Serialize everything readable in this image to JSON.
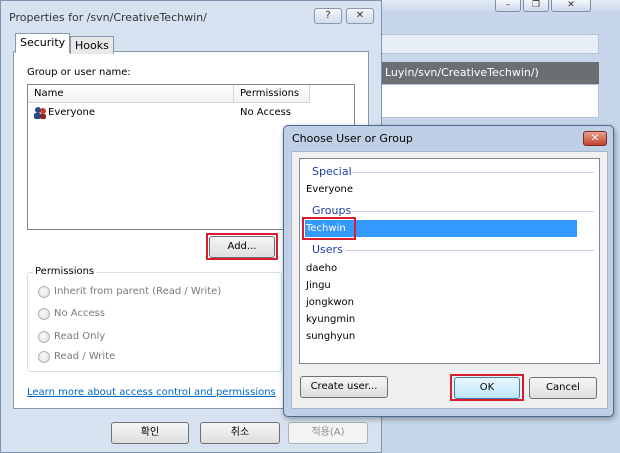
{
  "background_window": {
    "path_text": "Luyin/svn/CreativeTechwin/)",
    "btn_minimize": "–",
    "btn_restore": "❐",
    "btn_close": "✕"
  },
  "properties_window": {
    "title": "Properties for /svn/CreativeTechwin/",
    "help_label": "?",
    "close_label": "✕",
    "tabs": [
      {
        "label": "Security"
      },
      {
        "label": "Hooks"
      }
    ],
    "group_label": "Group or user name:",
    "columns": {
      "name": "Name",
      "permissions": "Permissions"
    },
    "rows": [
      {
        "name": "Everyone",
        "permission": "No Access"
      }
    ],
    "add_button": "Add...",
    "permissions_group_label": "Permissions",
    "permission_options": [
      {
        "label": "Inherit from parent (Read / Write)"
      },
      {
        "label": "No Access"
      },
      {
        "label": "Read Only"
      },
      {
        "label": "Read / Write"
      }
    ],
    "learn_link": "Learn more about access control and permissions",
    "ok_button": "확인",
    "cancel_button": "취소",
    "apply_button": "적용(A)"
  },
  "choose_dialog": {
    "title": "Choose User or Group",
    "close_label": "✕",
    "sections": {
      "special": {
        "header": "Special",
        "items": [
          "Everyone"
        ]
      },
      "groups": {
        "header": "Groups",
        "items": [
          "Techwin"
        ],
        "selected": "Techwin"
      },
      "users": {
        "header": "Users",
        "items": [
          "daeho",
          "Jingu",
          "jongkwon",
          "kyungmin",
          "sunghyun"
        ]
      }
    },
    "create_user_button": "Create user...",
    "ok_button": "OK",
    "cancel_button": "Cancel"
  },
  "colors": {
    "selection": "#3399ff",
    "highlight_box": "#d81e2c",
    "group_header": "#1e3fa0",
    "link": "#0066cc"
  }
}
